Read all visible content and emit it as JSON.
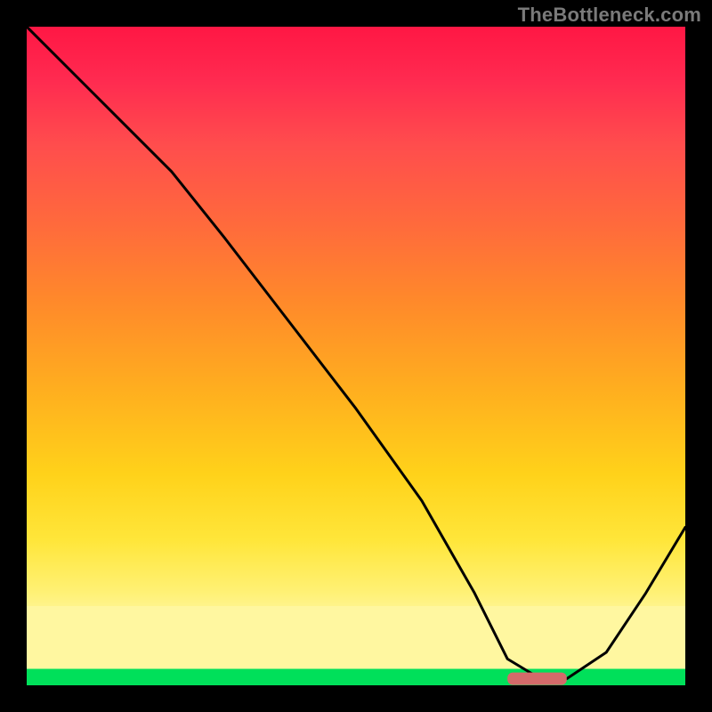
{
  "watermark": "TheBottleneck.com",
  "chart_data": {
    "type": "line",
    "title": "",
    "xlabel": "",
    "ylabel": "",
    "xlim": [
      0,
      100
    ],
    "ylim": [
      0,
      100
    ],
    "grid": false,
    "legend": false,
    "series": [
      {
        "name": "bottleneck-curve",
        "x": [
          0,
          10,
          22,
          30,
          40,
          50,
          60,
          68,
          73,
          78,
          82,
          88,
          94,
          100
        ],
        "y": [
          100,
          90,
          78,
          68,
          55,
          42,
          28,
          14,
          4,
          1,
          1,
          5,
          14,
          24
        ]
      }
    ],
    "marker": {
      "name": "optimal-range",
      "x_start": 73,
      "x_end": 82,
      "y": 1,
      "color": "#d46a6a"
    },
    "gradient_bands": [
      {
        "label": "red",
        "from_pct": 0,
        "to_pct": 18
      },
      {
        "label": "orange",
        "from_pct": 18,
        "to_pct": 55
      },
      {
        "label": "yellow",
        "from_pct": 55,
        "to_pct": 88
      },
      {
        "label": "pale",
        "from_pct": 88,
        "to_pct": 97.5
      },
      {
        "label": "green",
        "from_pct": 97.5,
        "to_pct": 100
      }
    ]
  }
}
